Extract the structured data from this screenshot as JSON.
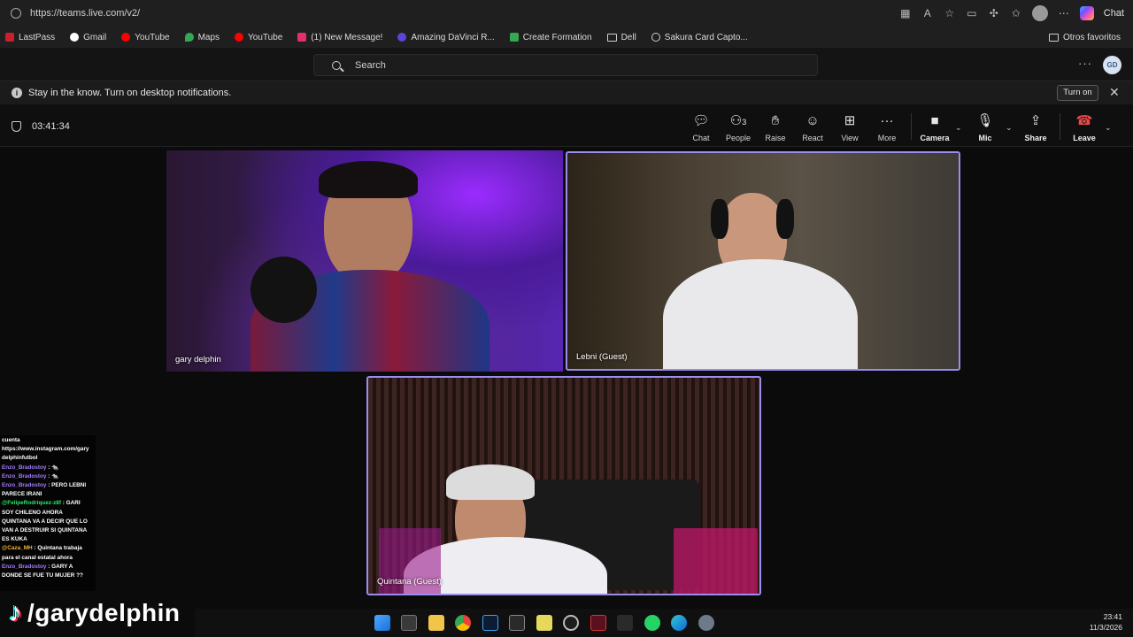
{
  "browser": {
    "url": "https://teams.live.com/v2/",
    "chat_label": "Chat",
    "bookmarks": [
      "LastPass",
      "Gmail",
      "YouTube",
      "Maps",
      "YouTube",
      "(1) New Message!",
      "Amazing DaVinci R...",
      "Create Formation",
      "Dell",
      "Sakura Card Capto..."
    ],
    "other_favorites": "Otros favoritos"
  },
  "teams": {
    "search_placeholder": "Search",
    "user_initials": "GD",
    "notification": "Stay in the know. Turn on desktop notifications.",
    "turn_on_label": "Turn on"
  },
  "meeting": {
    "timer": "03:41:34",
    "toolbar": {
      "chat": "Chat",
      "people": "People",
      "people_count": "3",
      "raise": "Raise",
      "react": "React",
      "view": "View",
      "more": "More",
      "camera": "Camera",
      "mic": "Mic",
      "share": "Share",
      "leave": "Leave"
    },
    "participants": {
      "p1": "gary delphin",
      "p2": "Lebni (Guest)",
      "p3": "Quintana (Guest)"
    }
  },
  "stream_chat": [
    {
      "user": "",
      "text": "cuenta"
    },
    {
      "user": "",
      "text": "https://www.instagram.com/gary"
    },
    {
      "user": "",
      "text": "delphinfutbol"
    },
    {
      "user": "Enzo_Bradostoy",
      "text": "🐀",
      "color": "#a77bff"
    },
    {
      "user": "Enzo_Bradostoy",
      "text": "🐀",
      "color": "#a77bff"
    },
    {
      "user": "Enzo_Bradostoy",
      "text": "PERO LEBNI",
      "color": "#a77bff"
    },
    {
      "user": "",
      "text": "PARECE IRANI"
    },
    {
      "user": "@FelipeRodriquez-z8f",
      "text": "GARI",
      "color": "#2ee86a"
    },
    {
      "user": "",
      "text": "SOY CHILENO AHORA"
    },
    {
      "user": "",
      "text": "QUINTANA VA A DECIR QUE LO"
    },
    {
      "user": "",
      "text": "VAN A DESTRUIR SI QUINTANA"
    },
    {
      "user": "",
      "text": "ES KUKA"
    },
    {
      "user": "@Caza_MH",
      "text": "Quintana trabaja",
      "color": "#f0b23a"
    },
    {
      "user": "",
      "text": "para el canal estatal ahora"
    },
    {
      "user": "Enzo_Bradostoy",
      "text": "GARY A",
      "color": "#a77bff"
    },
    {
      "user": "",
      "text": "DONDE SE FUE TU MUJER ??"
    }
  ],
  "watermark": {
    "note_glyph": "♪",
    "handle": "/garydelphin"
  },
  "taskbar": {
    "time": "23:41",
    "date": "11/3/2026"
  }
}
